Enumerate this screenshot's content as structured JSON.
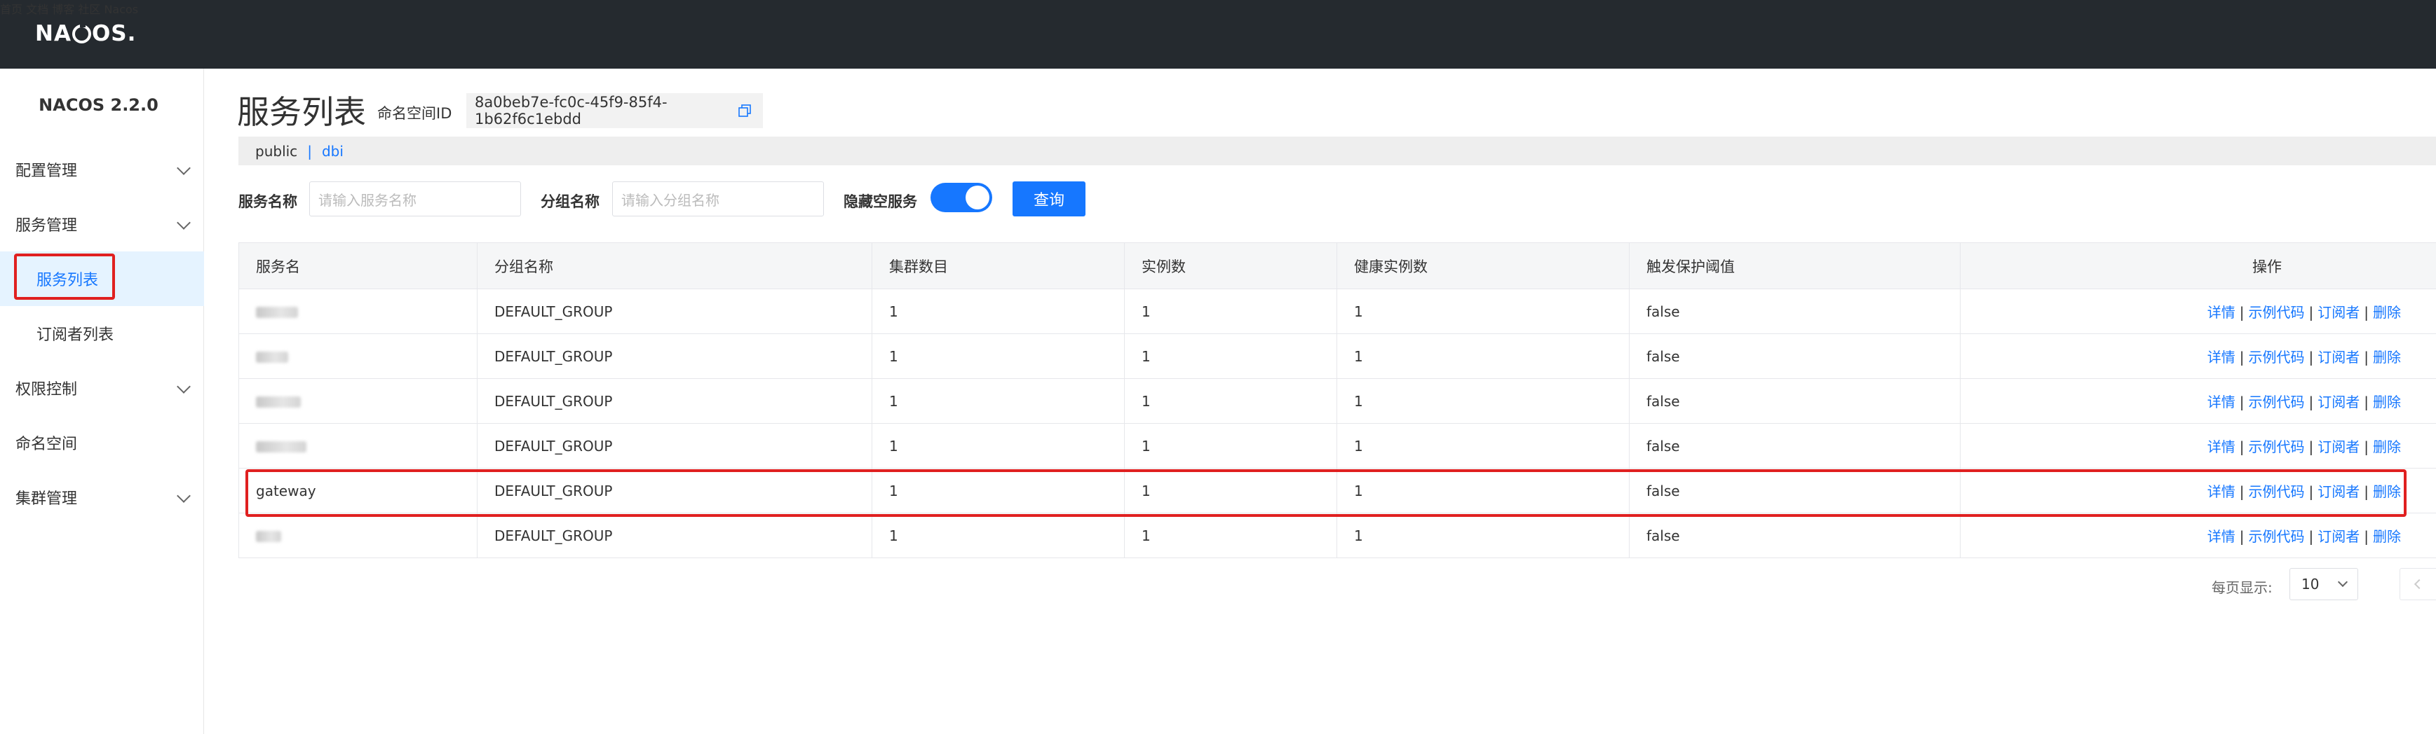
{
  "header": {
    "logo": [
      "NA",
      "C",
      "OS."
    ],
    "nav": [
      "首页",
      "文档",
      "博客",
      "社区",
      "Nacos"
    ]
  },
  "sidebar": {
    "title": "NACOS 2.2.0",
    "items": [
      {
        "label": "配置管理",
        "expandable": true
      },
      {
        "label": "服务管理",
        "expandable": true
      },
      {
        "label": "服务列表",
        "sub": true,
        "active": true
      },
      {
        "label": "订阅者列表",
        "sub": true
      },
      {
        "label": "权限控制",
        "expandable": true
      },
      {
        "label": "命名空间",
        "expandable": false
      },
      {
        "label": "集群管理",
        "expandable": true
      }
    ]
  },
  "page": {
    "title": "服务列表",
    "namespace_label": "命名空间ID",
    "namespace_id": "8a0beb7e-fc0c-45f9-85f4-1b62f6c1ebdd",
    "namespaces": [
      "public",
      "|",
      "dbi"
    ]
  },
  "filters": {
    "service_name_label": "服务名称",
    "service_name_placeholder": "请输入服务名称",
    "group_name_label": "分组名称",
    "group_name_placeholder": "请输入分组名称",
    "hide_empty_label": "隐藏空服务",
    "hide_empty_on": true,
    "query_button": "查询"
  },
  "table": {
    "columns": [
      "服务名",
      "分组名称",
      "集群数目",
      "实例数",
      "健康实例数",
      "触发保护阈值",
      "操作"
    ],
    "rows": [
      {
        "name": "",
        "group": "DEFAULT_GROUP",
        "clusters": "1",
        "instances": "1",
        "healthy": "1",
        "threshold": "false"
      },
      {
        "name": "",
        "group": "DEFAULT_GROUP",
        "clusters": "1",
        "instances": "1",
        "healthy": "1",
        "threshold": "false"
      },
      {
        "name": "",
        "group": "DEFAULT_GROUP",
        "clusters": "1",
        "instances": "1",
        "healthy": "1",
        "threshold": "false"
      },
      {
        "name": "",
        "group": "DEFAULT_GROUP",
        "clusters": "1",
        "instances": "1",
        "healthy": "1",
        "threshold": "false"
      },
      {
        "name": "gateway",
        "group": "DEFAULT_GROUP",
        "clusters": "1",
        "instances": "1",
        "healthy": "1",
        "threshold": "false"
      },
      {
        "name": "",
        "group": "DEFAULT_GROUP",
        "clusters": "1",
        "instances": "1",
        "healthy": "1",
        "threshold": "false"
      }
    ],
    "actions": [
      "详情",
      "示例代码",
      "订阅者",
      "删除"
    ]
  },
  "pager": {
    "per_page_label": "每页显示:",
    "per_page_value": "10"
  },
  "colors": {
    "accent": "#1677ff",
    "header_bg": "#252a2f",
    "highlight": "#e02020"
  }
}
